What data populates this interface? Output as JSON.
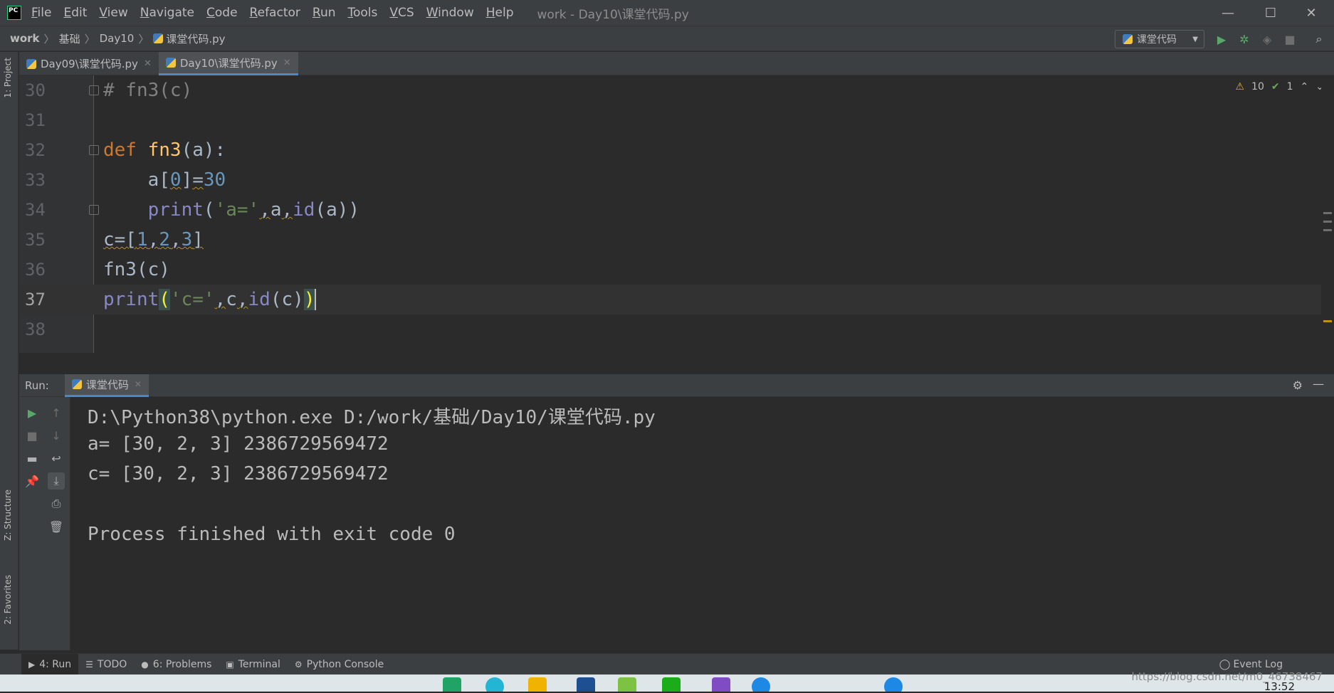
{
  "menu": {
    "items": [
      "File",
      "Edit",
      "View",
      "Navigate",
      "Code",
      "Refactor",
      "Run",
      "Tools",
      "VCS",
      "Window",
      "Help"
    ],
    "window_title": "work - Day10\\课堂代码.py"
  },
  "window_controls": {
    "minimize": "—",
    "maximize": "☐",
    "close": "✕"
  },
  "breadcrumb": [
    "work",
    "基础",
    "Day10",
    "课堂代码.py"
  ],
  "run_config": {
    "label": "课堂代码"
  },
  "left_strip": {
    "project": "1: Project",
    "structure": "Z: Structure",
    "favorites": "2: Favorites"
  },
  "tabs": [
    {
      "label": "Day09\\课堂代码.py",
      "active": false
    },
    {
      "label": "Day10\\课堂代码.py",
      "active": true
    }
  ],
  "inspections": {
    "warnings": "10",
    "weak_warnings": "1"
  },
  "editor": {
    "line_numbers": [
      "30",
      "31",
      "32",
      "33",
      "34",
      "35",
      "36",
      "37",
      "38"
    ],
    "current_line": "37"
  },
  "run_panel": {
    "label": "Run:",
    "tab_label": "课堂代码",
    "output": [
      "D:\\Python38\\python.exe D:/work/基础/Day10/课堂代码.py",
      "a= [30, 2, 3] 2386729569472",
      "c= [30, 2, 3] 2386729569472",
      "",
      "Process finished with exit code 0"
    ]
  },
  "bottom_tools": {
    "run": "4: Run",
    "todo": "TODO",
    "problems": "6: Problems",
    "terminal": "Terminal",
    "python_console": "Python Console",
    "event_log": "Event Log"
  },
  "watermark": "https://blog.csdn.net/m0_46738467",
  "clock": "13:52"
}
